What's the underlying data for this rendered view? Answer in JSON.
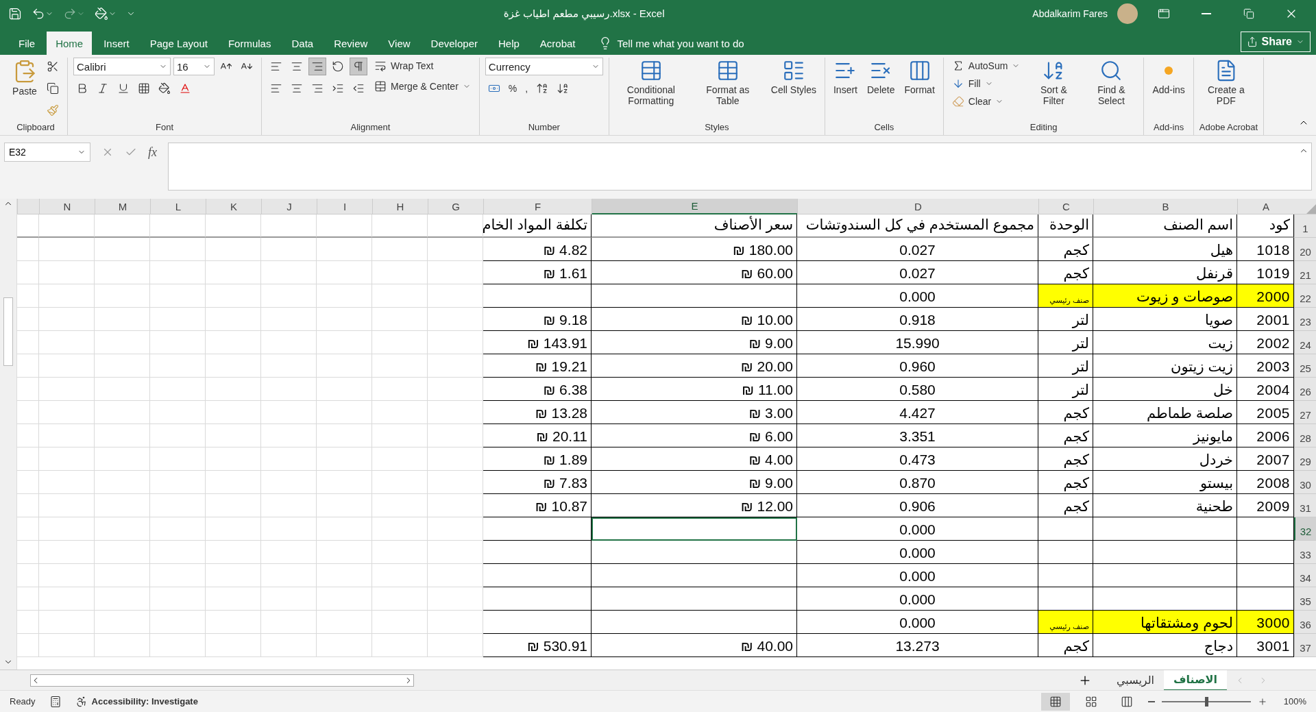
{
  "title_bar": {
    "title": "رسيبي مطعم اطياب غزة.xlsx  -  Excel",
    "user": "Abdalkarim Fares"
  },
  "menu_tabs": [
    {
      "label": "File",
      "selected": false
    },
    {
      "label": "Home",
      "selected": true
    },
    {
      "label": "Insert",
      "selected": false
    },
    {
      "label": "Page Layout",
      "selected": false
    },
    {
      "label": "Formulas",
      "selected": false
    },
    {
      "label": "Data",
      "selected": false
    },
    {
      "label": "Review",
      "selected": false
    },
    {
      "label": "View",
      "selected": false
    },
    {
      "label": "Developer",
      "selected": false
    },
    {
      "label": "Help",
      "selected": false
    },
    {
      "label": "Acrobat",
      "selected": false
    }
  ],
  "tell_me": "Tell me what you want to do",
  "share": "Share",
  "ribbon": {
    "clipboard": {
      "label": "Clipboard",
      "paste": "Paste"
    },
    "font": {
      "label": "Font",
      "name": "Calibri",
      "size": "16"
    },
    "alignment": {
      "label": "Alignment",
      "align_buttons": [
        {
          "kind": "top",
          "selected": false
        },
        {
          "kind": "middle",
          "selected": false
        },
        {
          "kind": "bottom",
          "selected": true
        }
      ],
      "rtl": {
        "selected": true
      },
      "wrap": "Wrap Text",
      "merge": "Merge & Center"
    },
    "number": {
      "label": "Number",
      "format": "Currency",
      "percent": "%",
      "comma": ","
    },
    "styles": {
      "label": "Styles",
      "buttons": [
        "Conditional Formatting",
        "Format as Table",
        "Cell Styles"
      ]
    },
    "cells": {
      "label": "Cells",
      "buttons": [
        "Insert",
        "Delete",
        "Format"
      ]
    },
    "editing": {
      "label": "Editing",
      "autosum": "AutoSum",
      "fill": "Fill",
      "clear": "Clear",
      "sort": "Sort & Filter",
      "find": "Find & Select"
    },
    "addins": {
      "label": "Add-ins",
      "button": "Add-ins"
    },
    "acrobat": {
      "label": "Adobe Acrobat",
      "button": "Create a PDF"
    }
  },
  "formula_bar": {
    "name_box": "E32",
    "fx": "fx"
  },
  "columns": [
    {
      "label": "N",
      "selected": false
    },
    {
      "label": "M",
      "selected": false
    },
    {
      "label": "L",
      "selected": false
    },
    {
      "label": "K",
      "selected": false
    },
    {
      "label": "J",
      "selected": false
    },
    {
      "label": "I",
      "selected": false
    },
    {
      "label": "H",
      "selected": false
    },
    {
      "label": "G",
      "selected": false
    },
    {
      "label": "F",
      "selected": false
    },
    {
      "label": "E",
      "selected": true
    },
    {
      "label": "D",
      "selected": false
    },
    {
      "label": "C",
      "selected": false
    },
    {
      "label": "B",
      "selected": false
    },
    {
      "label": "A",
      "selected": false
    }
  ],
  "rows": [
    {
      "number": "1",
      "selected": false,
      "cells": {
        "F": {
          "text": "تكلفة المواد الخام",
          "kind": "header",
          "highlight": false
        },
        "E": {
          "text": "سعر الأصناف",
          "kind": "header",
          "highlight": false
        },
        "D": {
          "text": "مجموع المستخدم في كل السندوتشات",
          "kind": "header",
          "highlight": false
        },
        "C": {
          "text": "الوحدة",
          "kind": "header",
          "highlight": false
        },
        "B": {
          "text": "اسم الصنف",
          "kind": "header",
          "highlight": false
        },
        "A": {
          "text": "كود",
          "kind": "header",
          "highlight": false
        }
      }
    },
    {
      "number": "20",
      "selected": false,
      "cells": {
        "F": {
          "text": "₪ 4.82",
          "kind": "currency",
          "highlight": false
        },
        "E": {
          "text": "₪ 180.00",
          "kind": "currency",
          "highlight": false
        },
        "D": {
          "text": "0.027",
          "kind": "quantity",
          "highlight": false
        },
        "C": {
          "text": "كجم",
          "kind": "text",
          "highlight": false
        },
        "B": {
          "text": "هيل",
          "kind": "text",
          "highlight": false
        },
        "A": {
          "text": "1018",
          "kind": "code",
          "highlight": false
        }
      }
    },
    {
      "number": "21",
      "selected": false,
      "cells": {
        "F": {
          "text": "₪ 1.61",
          "kind": "currency",
          "highlight": false
        },
        "E": {
          "text": "₪ 60.00",
          "kind": "currency",
          "highlight": false
        },
        "D": {
          "text": "0.027",
          "kind": "quantity",
          "highlight": false
        },
        "C": {
          "text": "كجم",
          "kind": "text",
          "highlight": false
        },
        "B": {
          "text": "قرنفل",
          "kind": "text",
          "highlight": false
        },
        "A": {
          "text": "1019",
          "kind": "code",
          "highlight": false
        }
      }
    },
    {
      "number": "22",
      "selected": false,
      "cells": {
        "D": {
          "text": "0.000",
          "kind": "quantity",
          "highlight": false
        },
        "C": {
          "text": "صنف رئيسي",
          "kind": "label",
          "highlight": true
        },
        "B": {
          "text": "صوصات و زيوت",
          "kind": "text",
          "highlight": true
        },
        "A": {
          "text": "2000",
          "kind": "code",
          "highlight": true
        }
      }
    },
    {
      "number": "23",
      "selected": false,
      "cells": {
        "F": {
          "text": "₪ 9.18",
          "kind": "currency",
          "highlight": false
        },
        "E": {
          "text": "₪ 10.00",
          "kind": "currency",
          "highlight": false
        },
        "D": {
          "text": "0.918",
          "kind": "quantity",
          "highlight": false
        },
        "C": {
          "text": "لتر",
          "kind": "text",
          "highlight": false
        },
        "B": {
          "text": "صويا",
          "kind": "text",
          "highlight": false
        },
        "A": {
          "text": "2001",
          "kind": "code",
          "highlight": false
        }
      }
    },
    {
      "number": "24",
      "selected": false,
      "cells": {
        "F": {
          "text": "₪ 143.91",
          "kind": "currency",
          "highlight": false
        },
        "E": {
          "text": "₪ 9.00",
          "kind": "currency",
          "highlight": false
        },
        "D": {
          "text": "15.990",
          "kind": "quantity",
          "highlight": false
        },
        "C": {
          "text": "لتر",
          "kind": "text",
          "highlight": false
        },
        "B": {
          "text": "زيت",
          "kind": "text",
          "highlight": false
        },
        "A": {
          "text": "2002",
          "kind": "code",
          "highlight": false
        }
      }
    },
    {
      "number": "25",
      "selected": false,
      "cells": {
        "F": {
          "text": "₪ 19.21",
          "kind": "currency",
          "highlight": false
        },
        "E": {
          "text": "₪ 20.00",
          "kind": "currency",
          "highlight": false
        },
        "D": {
          "text": "0.960",
          "kind": "quantity",
          "highlight": false
        },
        "C": {
          "text": "لتر",
          "kind": "text",
          "highlight": false
        },
        "B": {
          "text": "زيت زيتون",
          "kind": "text",
          "highlight": false
        },
        "A": {
          "text": "2003",
          "kind": "code",
          "highlight": false
        }
      }
    },
    {
      "number": "26",
      "selected": false,
      "cells": {
        "F": {
          "text": "₪ 6.38",
          "kind": "currency",
          "highlight": false
        },
        "E": {
          "text": "₪ 11.00",
          "kind": "currency",
          "highlight": false
        },
        "D": {
          "text": "0.580",
          "kind": "quantity",
          "highlight": false
        },
        "C": {
          "text": "لتر",
          "kind": "text",
          "highlight": false
        },
        "B": {
          "text": "خل",
          "kind": "text",
          "highlight": false
        },
        "A": {
          "text": "2004",
          "kind": "code",
          "highlight": false
        }
      }
    },
    {
      "number": "27",
      "selected": false,
      "cells": {
        "F": {
          "text": "₪ 13.28",
          "kind": "currency",
          "highlight": false
        },
        "E": {
          "text": "₪ 3.00",
          "kind": "currency",
          "highlight": false
        },
        "D": {
          "text": "4.427",
          "kind": "quantity",
          "highlight": false
        },
        "C": {
          "text": "كجم",
          "kind": "text",
          "highlight": false
        },
        "B": {
          "text": "صلصة طماطم",
          "kind": "text",
          "highlight": false
        },
        "A": {
          "text": "2005",
          "kind": "code",
          "highlight": false
        }
      }
    },
    {
      "number": "28",
      "selected": false,
      "cells": {
        "F": {
          "text": "₪ 20.11",
          "kind": "currency",
          "highlight": false
        },
        "E": {
          "text": "₪ 6.00",
          "kind": "currency",
          "highlight": false
        },
        "D": {
          "text": "3.351",
          "kind": "quantity",
          "highlight": false
        },
        "C": {
          "text": "كجم",
          "kind": "text",
          "highlight": false
        },
        "B": {
          "text": "مايونيز",
          "kind": "text",
          "highlight": false
        },
        "A": {
          "text": "2006",
          "kind": "code",
          "highlight": false
        }
      }
    },
    {
      "number": "29",
      "selected": false,
      "cells": {
        "F": {
          "text": "₪ 1.89",
          "kind": "currency",
          "highlight": false
        },
        "E": {
          "text": "₪ 4.00",
          "kind": "currency",
          "highlight": false
        },
        "D": {
          "text": "0.473",
          "kind": "quantity",
          "highlight": false
        },
        "C": {
          "text": "كجم",
          "kind": "text",
          "highlight": false
        },
        "B": {
          "text": "خردل",
          "kind": "text",
          "highlight": false
        },
        "A": {
          "text": "2007",
          "kind": "code",
          "highlight": false
        }
      }
    },
    {
      "number": "30",
      "selected": false,
      "cells": {
        "F": {
          "text": "₪ 7.83",
          "kind": "currency",
          "highlight": false
        },
        "E": {
          "text": "₪ 9.00",
          "kind": "currency",
          "highlight": false
        },
        "D": {
          "text": "0.870",
          "kind": "quantity",
          "highlight": false
        },
        "C": {
          "text": "كجم",
          "kind": "text",
          "highlight": false
        },
        "B": {
          "text": "بيستو",
          "kind": "text",
          "highlight": false
        },
        "A": {
          "text": "2008",
          "kind": "code",
          "highlight": false
        }
      }
    },
    {
      "number": "31",
      "selected": false,
      "cells": {
        "F": {
          "text": "₪ 10.87",
          "kind": "currency",
          "highlight": false
        },
        "E": {
          "text": "₪ 12.00",
          "kind": "currency",
          "highlight": false
        },
        "D": {
          "text": "0.906",
          "kind": "quantity",
          "highlight": false
        },
        "C": {
          "text": "كجم",
          "kind": "text",
          "highlight": false
        },
        "B": {
          "text": "طحنية",
          "kind": "text",
          "highlight": false
        },
        "A": {
          "text": "2009",
          "kind": "code",
          "highlight": false
        }
      }
    },
    {
      "number": "32",
      "selected": true,
      "cells": {
        "D": {
          "text": "0.000",
          "kind": "quantity",
          "highlight": false
        }
      }
    },
    {
      "number": "33",
      "selected": false,
      "cells": {
        "D": {
          "text": "0.000",
          "kind": "quantity",
          "highlight": false
        }
      }
    },
    {
      "number": "34",
      "selected": false,
      "cells": {
        "D": {
          "text": "0.000",
          "kind": "quantity",
          "highlight": false
        }
      }
    },
    {
      "number": "35",
      "selected": false,
      "cells": {
        "D": {
          "text": "0.000",
          "kind": "quantity",
          "highlight": false
        }
      }
    },
    {
      "number": "36",
      "selected": false,
      "cells": {
        "D": {
          "text": "0.000",
          "kind": "quantity",
          "highlight": false
        },
        "C": {
          "text": "صنف رئيسي",
          "kind": "label",
          "highlight": true
        },
        "B": {
          "text": "لحوم ومشتقاتها",
          "kind": "text",
          "highlight": true
        },
        "A": {
          "text": "3000",
          "kind": "code",
          "highlight": true
        }
      }
    },
    {
      "number": "37",
      "selected": false,
      "cells": {
        "F": {
          "text": "₪ 530.91",
          "kind": "currency",
          "highlight": false
        },
        "E": {
          "text": "₪ 40.00",
          "kind": "currency",
          "highlight": false
        },
        "D": {
          "text": "13.273",
          "kind": "quantity",
          "highlight": false
        },
        "C": {
          "text": "كجم",
          "kind": "text",
          "highlight": false
        },
        "B": {
          "text": "دجاج",
          "kind": "text",
          "highlight": false
        },
        "A": {
          "text": "3001",
          "kind": "code",
          "highlight": false
        }
      }
    }
  ],
  "sheet_tabs": [
    {
      "label": "الاصناف",
      "selected": true
    },
    {
      "label": "الريسبي",
      "selected": false
    }
  ],
  "status_bar": {
    "ready": "Ready",
    "accessibility": "Accessibility: Investigate",
    "zoom": "100%",
    "zoom_slider": {
      "level": 0.5
    }
  }
}
